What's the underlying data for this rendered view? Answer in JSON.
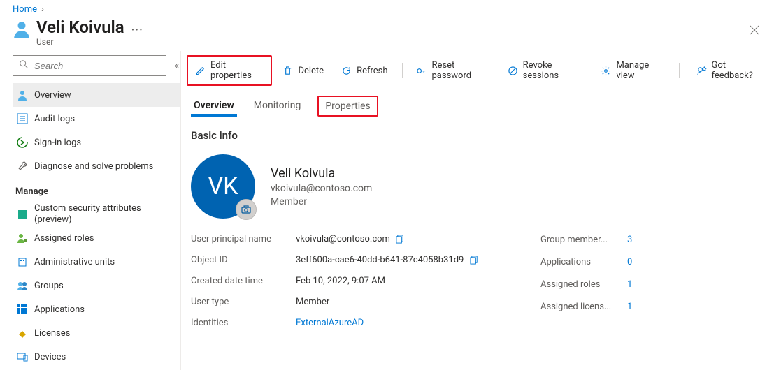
{
  "breadcrumb": {
    "home": "Home"
  },
  "header": {
    "title": "Veli Koivula",
    "subtitle": "User"
  },
  "sidebar": {
    "search_placeholder": "Search",
    "items": [
      {
        "label": "Overview"
      },
      {
        "label": "Audit logs"
      },
      {
        "label": "Sign-in logs"
      },
      {
        "label": "Diagnose and solve problems"
      }
    ],
    "manage_title": "Manage",
    "manage_items": [
      {
        "label": "Custom security attributes (preview)"
      },
      {
        "label": "Assigned roles"
      },
      {
        "label": "Administrative units"
      },
      {
        "label": "Groups"
      },
      {
        "label": "Applications"
      },
      {
        "label": "Licenses"
      },
      {
        "label": "Devices"
      }
    ]
  },
  "toolbar": {
    "edit_properties": "Edit properties",
    "delete": "Delete",
    "refresh": "Refresh",
    "reset_password": "Reset password",
    "revoke_sessions": "Revoke sessions",
    "manage_view": "Manage view",
    "got_feedback": "Got feedback?"
  },
  "tabs": [
    {
      "label": "Overview"
    },
    {
      "label": "Monitoring"
    },
    {
      "label": "Properties"
    }
  ],
  "basic_info": {
    "section_title": "Basic info",
    "avatar_initials": "VK",
    "full_name": "Veli Koivula",
    "email": "vkoivula@contoso.com",
    "member_type": "Member"
  },
  "details": {
    "user_principal_name": {
      "label": "User principal name",
      "value": "vkoivula@contoso.com"
    },
    "object_id": {
      "label": "Object ID",
      "value": "3eff600a-cae6-40dd-b641-87c4058b31d9"
    },
    "created_date_time": {
      "label": "Created date time",
      "value": "Feb 10, 2022, 9:07 AM"
    },
    "user_type": {
      "label": "User type",
      "value": "Member"
    },
    "identities": {
      "label": "Identities",
      "value": "ExternalAzureAD"
    }
  },
  "summary": {
    "group_memberships": {
      "label": "Group member...",
      "value": "3"
    },
    "applications": {
      "label": "Applications",
      "value": "0"
    },
    "assigned_roles": {
      "label": "Assigned roles",
      "value": "1"
    },
    "assigned_licenses": {
      "label": "Assigned licens...",
      "value": "1"
    }
  }
}
